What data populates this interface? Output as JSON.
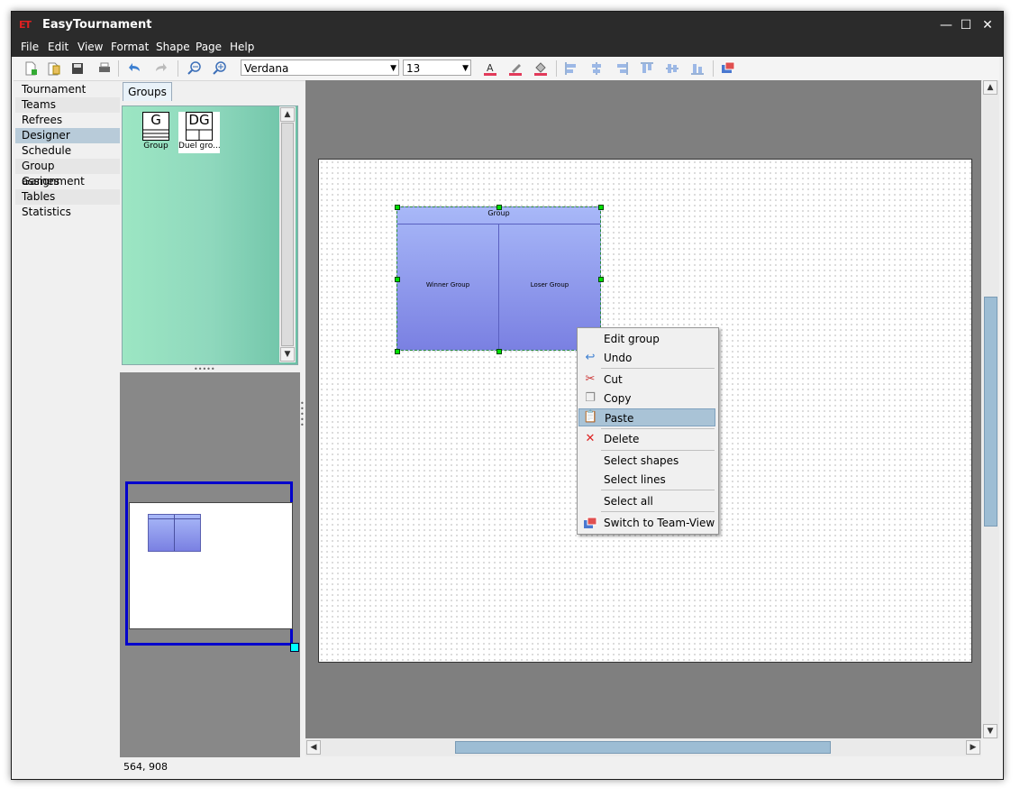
{
  "window": {
    "title": "EasyTournament",
    "app_icon_text": "ET"
  },
  "titlebar_buttons": {
    "minimize": "—",
    "maximize": "☐",
    "close": "✕"
  },
  "menu": [
    "File",
    "Edit",
    "View",
    "Format",
    "Shape",
    "Page",
    "Help"
  ],
  "toolbar": {
    "font_name": "Verdana",
    "font_size": "13"
  },
  "nav": {
    "items": [
      "Tournament details",
      "Teams",
      "Refrees",
      "Designer",
      "Schedule",
      "Group assignment",
      "Games",
      "Tables",
      "Statistics"
    ],
    "selected": "Designer"
  },
  "palette": {
    "tab": "Groups",
    "shapes": [
      {
        "glyph": "G",
        "label": "Group"
      },
      {
        "glyph": "DG",
        "label": "Duel gro..."
      }
    ]
  },
  "canvas": {
    "group_title": "Group",
    "left_label": "Winner Group",
    "right_label": "Loser Group"
  },
  "context_menu": {
    "items": [
      "Edit group",
      "Undo",
      "Cut",
      "Copy",
      "Paste",
      "Delete",
      "Select shapes",
      "Select lines",
      "Select all",
      "Switch to Team-View"
    ],
    "highlighted": "Paste"
  },
  "status": {
    "coords": "564, 908"
  },
  "colors": {
    "accent_selection": "#b8cbd9",
    "overview_frame": "#0000cc",
    "shape_fill": "#8c95ea",
    "handle": "#00e000"
  }
}
